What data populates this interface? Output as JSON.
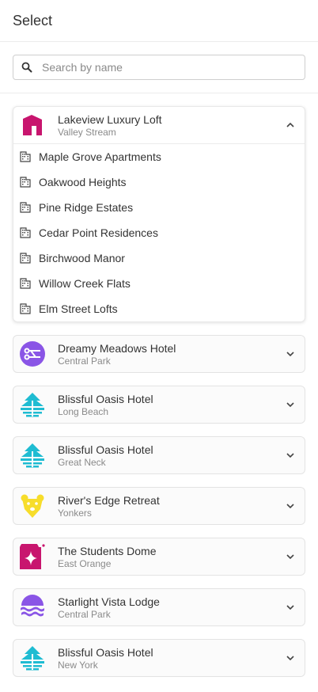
{
  "header": {
    "title": "Select"
  },
  "search": {
    "placeholder": "Search by name",
    "value": ""
  },
  "expanded": {
    "title": "Lakeview Luxury Loft",
    "subtitle": "Valley Stream",
    "logo": "house-logo",
    "items": [
      {
        "label": "Maple Grove Apartments"
      },
      {
        "label": "Oakwood Heights"
      },
      {
        "label": "Pine Ridge Estates"
      },
      {
        "label": "Cedar Point Residences"
      },
      {
        "label": "Birchwood Manor"
      },
      {
        "label": "Willow Creek Flats"
      },
      {
        "label": "Elm Street Lofts"
      }
    ]
  },
  "properties": [
    {
      "title": "Dreamy Meadows Hotel",
      "subtitle": "Central Park",
      "logo": "network-logo"
    },
    {
      "title": "Blissful Oasis Hotel",
      "subtitle": "Long Beach",
      "logo": "pine-logo"
    },
    {
      "title": "Blissful Oasis Hotel",
      "subtitle": "Great Neck",
      "logo": "pine-logo"
    },
    {
      "title": "River's Edge Retreat",
      "subtitle": "Yonkers",
      "logo": "bear-logo"
    },
    {
      "title": "The Students Dome",
      "subtitle": "East Orange",
      "logo": "star-logo"
    },
    {
      "title": "Starlight Vista Lodge",
      "subtitle": "Central Park",
      "logo": "waves-logo"
    },
    {
      "title": "Blissful Oasis Hotel",
      "subtitle": "New York",
      "logo": "pine-logo"
    }
  ],
  "colors": {
    "house": "#c8156e",
    "network": "#8a55e6",
    "pine": "#1fbcd2",
    "bear": "#f7dd2b",
    "star": "#c8156e",
    "waves": "#8a55e6"
  }
}
